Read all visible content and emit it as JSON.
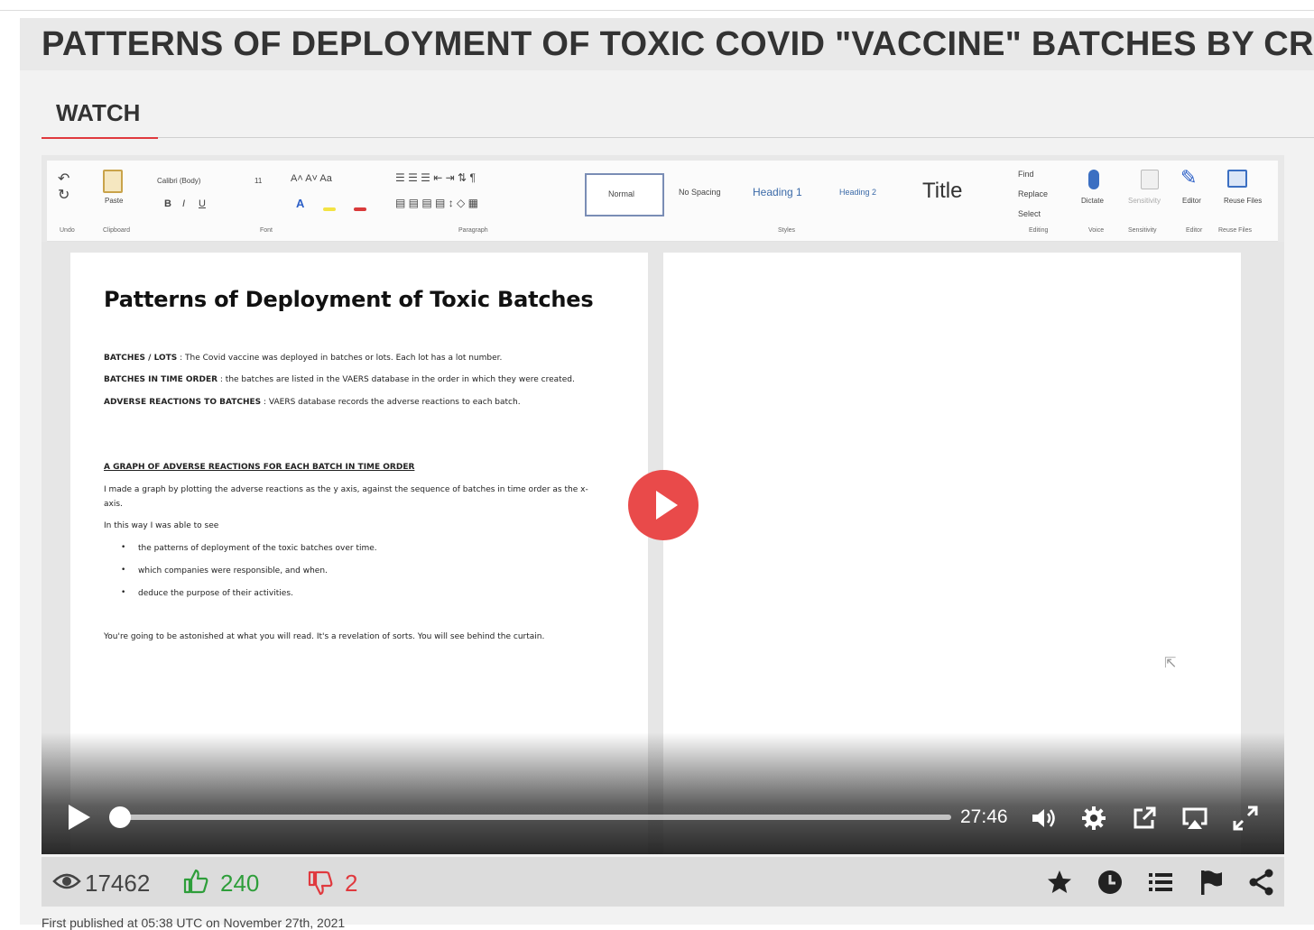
{
  "page": {
    "title": "PATTERNS OF DEPLOYMENT OF TOXIC COVID \"VACCINE\" BATCHES BY CR",
    "tab_watch": "WATCH",
    "published": "First published at 05:38 UTC on November 27th, 2021"
  },
  "ribbon": {
    "font_name": "Calibri (Body)",
    "font_size": "11",
    "styles": [
      "Normal",
      "No Spacing",
      "Heading 1",
      "Heading 2",
      "Title"
    ],
    "editing": [
      "Find",
      "Replace",
      "Select"
    ],
    "buttons": [
      "Paste",
      "Dictate",
      "Sensitivity",
      "Editor",
      "Reuse Files"
    ],
    "groups": [
      "Undo",
      "Clipboard",
      "Font",
      "Paragraph",
      "Styles",
      "Editing",
      "Voice",
      "Sensitivity",
      "Editor",
      "Reuse Files"
    ]
  },
  "document": {
    "title": "Patterns of Deployment of Toxic Batches",
    "lines": [
      {
        "bold": "BATCHES / LOTS",
        "text": " : The Covid vaccine was deployed in batches or lots. Each lot has a lot number."
      },
      {
        "bold": "BATCHES IN TIME ORDER",
        "text": " : the batches are listed in the VAERS database in the order in which they were created."
      },
      {
        "bold": "ADVERSE REACTIONS TO BATCHES",
        "text": " : VAERS database records the adverse reactions to each batch."
      }
    ],
    "section_heading": "A GRAPH OF ADVERSE REACTIONS FOR EACH BATCH IN TIME ORDER",
    "para1a": "I made a graph by plotting the adverse reactions as the y axis, against the sequence of batches in time order as the x-",
    "para1b": "axis.",
    "para2": "In this way I was able to see",
    "bullets": [
      "the patterns of deployment of the toxic batches over time.",
      "which companies were responsible, and when.",
      "deduce the purpose of their activities."
    ],
    "closing": "You're going to be astonished at what you will read. It's a revelation of sorts. You will see behind the curtain."
  },
  "player": {
    "time": "27:46",
    "progress": 0.0,
    "play_color": "#e94a4a"
  },
  "stats": {
    "views": "17462",
    "likes": "240",
    "dislikes": "2",
    "like_color": "#2e9e3a",
    "dislike_color": "#e0393e"
  }
}
